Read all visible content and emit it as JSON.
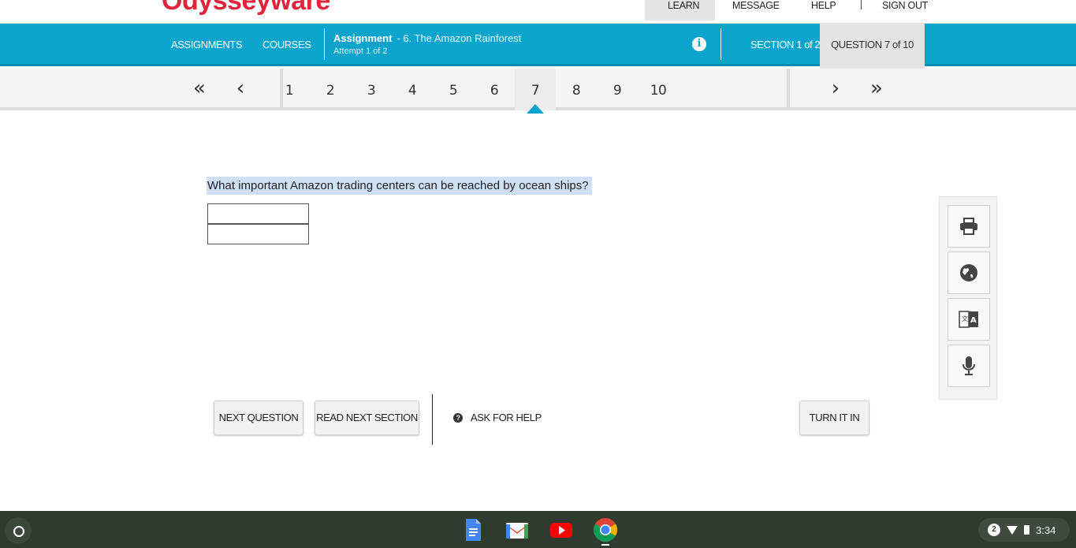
{
  "header": {
    "logo_text": "Odysseyware",
    "links": [
      "LEARN",
      "MESSAGE",
      "HELP",
      "SIGN OUT"
    ]
  },
  "bluebar": {
    "assignments": "ASSIGNMENTS",
    "courses": "COURSES",
    "assignment_label": "Assignment",
    "assignment_name": "- 6. The Amazon Rainforest",
    "attempt": "Attempt 1 of 2",
    "section": "SECTION 1 of 2",
    "question": "QUESTION 7 of 10"
  },
  "nav": {
    "questions": [
      "1",
      "2",
      "3",
      "4",
      "5",
      "6",
      "7",
      "8",
      "9",
      "10"
    ],
    "active_index": 6
  },
  "question": {
    "text": "What important Amazon trading centers can be reached by ocean ships?"
  },
  "tools": [
    "print-icon",
    "globe-icon",
    "translate-icon",
    "microphone-icon"
  ],
  "actions": {
    "next_question": "NEXT QUESTION",
    "read_next_section": "READ NEXT SECTION",
    "ask_for_help": "ASK FOR HELP",
    "turn_it_in": "TURN IT IN"
  },
  "taskbar": {
    "apps": [
      "google-docs-icon",
      "gmail-icon",
      "youtube-icon",
      "chrome-icon"
    ],
    "notification_count": "2",
    "time": "3:34"
  },
  "colors": {
    "brand_red": "#e0243b",
    "accent_blue": "#0aa4cd"
  }
}
